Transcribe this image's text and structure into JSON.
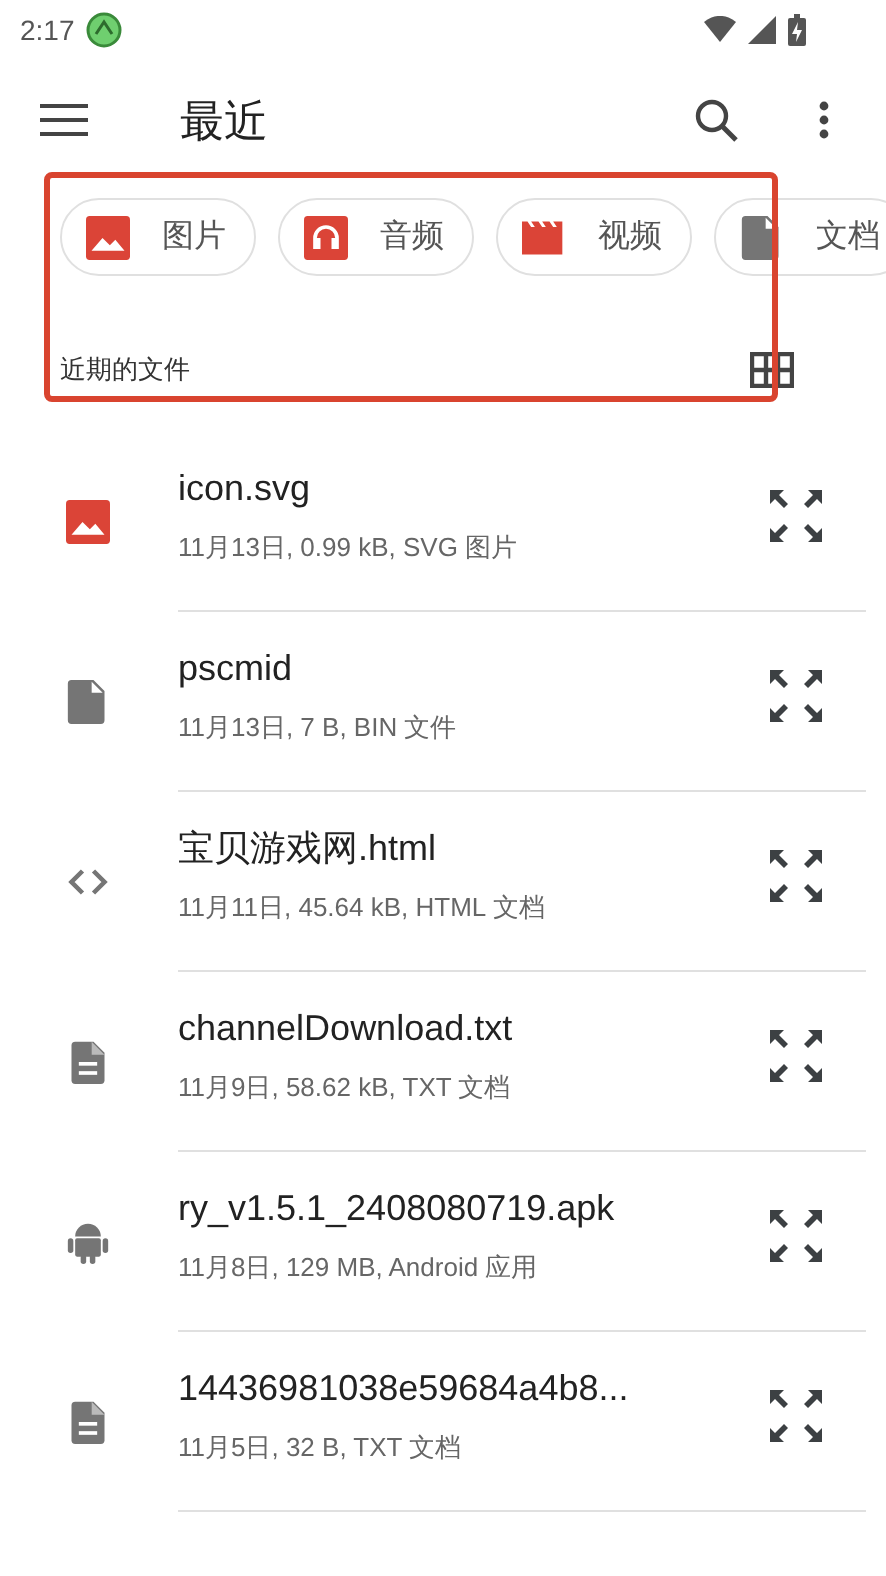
{
  "status_bar": {
    "time": "2:17"
  },
  "toolbar": {
    "title": "最近"
  },
  "chips": [
    {
      "label": "图片",
      "kind": "image"
    },
    {
      "label": "音频",
      "kind": "audio"
    },
    {
      "label": "视频",
      "kind": "video"
    },
    {
      "label": "文档",
      "kind": "document"
    }
  ],
  "section": {
    "title": "近期的文件"
  },
  "files": [
    {
      "name": "icon.svg",
      "details": "11月13日, 0.99 kB, SVG 图片",
      "kind": "image"
    },
    {
      "name": "pscmid",
      "details": "11月13日, 7 B, BIN 文件",
      "kind": "file"
    },
    {
      "name": "宝贝游戏网.html",
      "details": "11月11日, 45.64 kB, HTML 文档",
      "kind": "code"
    },
    {
      "name": "channelDownload.txt",
      "details": "11月9日, 58.62 kB, TXT 文档",
      "kind": "text"
    },
    {
      "name": "ry_v1.5.1_2408080719.apk",
      "details": "11月8日, 129 MB, Android 应用",
      "kind": "android"
    },
    {
      "name": "14436981038e59684a4b8...",
      "details": "11月5日, 32 B, TXT 文档",
      "kind": "text"
    }
  ]
}
